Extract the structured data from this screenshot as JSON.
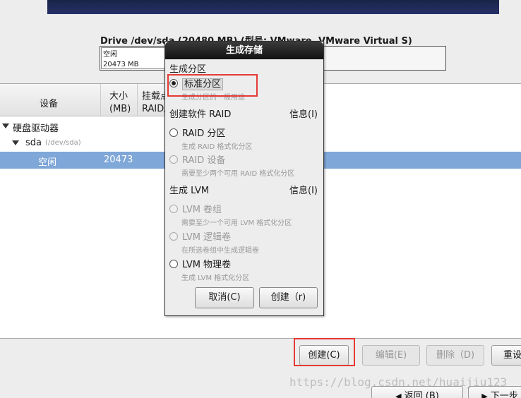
{
  "drive": {
    "title": "Drive /dev/sda (20480 MB) (型号: VMware, VMware Virtual S)",
    "map_label": "空闲",
    "map_size": "20473 MB"
  },
  "table": {
    "col_device": "设备",
    "col_size": "大小\n(MB)",
    "col_mount": "挂载点/\nRAID/",
    "rows": {
      "hd": "硬盘驱动器",
      "sda": "sda",
      "sda_path": "(/dev/sda)",
      "free_label": "空闲",
      "free_size": "20473"
    }
  },
  "buttons": {
    "create": "创建(C)",
    "edit": "编辑(E)",
    "delete": "删除（D)",
    "reset": "重设",
    "back": "返回 (B)",
    "next": "下一步"
  },
  "dialog": {
    "title": "生成存储",
    "section_partition": "生成分区",
    "standard_partition": "标准分区",
    "standard_desc": "生成分区的一般用途",
    "section_raid": "创建软件 RAID",
    "info": "信息(I)",
    "raid_partition": "RAID 分区",
    "raid_partition_desc": "生成 RAID 格式化分区",
    "raid_device": "RAID 设备",
    "raid_device_desc": "需要至少两个可用 RAID 格式化分区",
    "section_lvm": "生成 LVM",
    "lvm_vg": "LVM 卷组",
    "lvm_vg_desc": "需要至少一个可用 LVM 格式化分区",
    "lvm_lv": "LVM 逻辑卷",
    "lvm_lv_desc": "在所选卷组中生成逻辑卷",
    "lvm_pv": "LVM 物理卷",
    "lvm_pv_desc": "生成 LVM 格式化分区",
    "cancel": "取消(C)",
    "create": "创建（r)"
  },
  "watermark": "https://blog.csdn.net/huaijiu123",
  "colors": {
    "selection": "#7fa7d8",
    "highlight": "#e53935",
    "title_bar": "#1a1a1a"
  }
}
